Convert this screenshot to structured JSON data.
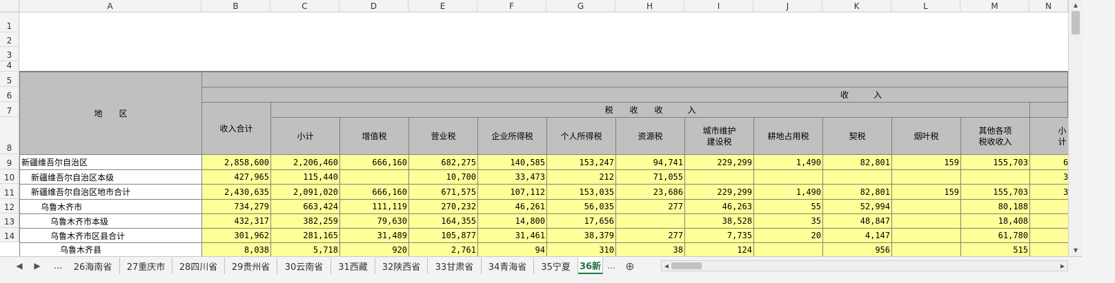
{
  "columns": [
    "A",
    "B",
    "C",
    "D",
    "E",
    "F",
    "G",
    "H",
    "I",
    "J",
    "K",
    "L",
    "M",
    "N"
  ],
  "row_numbers": [
    "1",
    "2",
    "3",
    "4",
    "5",
    "6",
    "7",
    "8",
    "9",
    "10",
    "11",
    "12",
    "13",
    "14"
  ],
  "header": {
    "region": "地　　区",
    "income_group": "收　　　入",
    "tax_group": "税　　收　　收　　　入",
    "total": "收入合计",
    "subtotal": "小计",
    "vat": "增值税",
    "business_tax": "营业税",
    "corporate_tax": "企业所得税",
    "personal_tax": "个人所得税",
    "resource_tax": "资源税",
    "urban_tax": "城市维护\n建设税",
    "land_tax": "耕地占用税",
    "deed_tax": "契税",
    "tobacco_tax": "烟叶税",
    "other_tax": "其他各项\n税收收入",
    "next_sub": "小计"
  },
  "rows": [
    {
      "name": "新疆维吾尔自治区",
      "indent": 0,
      "vals": [
        "2,858,600",
        "2,206,460",
        "666,160",
        "682,275",
        "140,585",
        "153,247",
        "94,741",
        "229,299",
        "1,490",
        "82,801",
        "159",
        "155,703",
        "6"
      ]
    },
    {
      "name": "新疆维吾尔自治区本级",
      "indent": 1,
      "vals": [
        "427,965",
        "115,440",
        "",
        "10,700",
        "33,473",
        "212",
        "71,055",
        "",
        "",
        "",
        "",
        "",
        "3"
      ]
    },
    {
      "name": "新疆维吾尔自治区地市合计",
      "indent": 1,
      "vals": [
        "2,430,635",
        "2,091,020",
        "666,160",
        "671,575",
        "107,112",
        "153,035",
        "23,686",
        "229,299",
        "1,490",
        "82,801",
        "159",
        "155,703",
        "3"
      ]
    },
    {
      "name": "乌鲁木齐市",
      "indent": 2,
      "vals": [
        "734,279",
        "663,424",
        "111,119",
        "270,232",
        "46,261",
        "56,035",
        "277",
        "46,263",
        "55",
        "52,994",
        "",
        "80,188",
        ""
      ]
    },
    {
      "name": "乌鲁木齐市本级",
      "indent": 3,
      "vals": [
        "432,317",
        "382,259",
        "79,630",
        "164,355",
        "14,800",
        "17,656",
        "",
        "38,528",
        "35",
        "48,847",
        "",
        "18,408",
        ""
      ]
    },
    {
      "name": "乌鲁木齐市区县合计",
      "indent": 3,
      "vals": [
        "301,962",
        "281,165",
        "31,489",
        "105,877",
        "31,461",
        "38,379",
        "277",
        "7,735",
        "20",
        "4,147",
        "",
        "61,780",
        ""
      ]
    },
    {
      "name": "乌鲁木齐县",
      "indent": 4,
      "vals": [
        "8,038",
        "5,718",
        "920",
        "2,761",
        "94",
        "310",
        "38",
        "124",
        "",
        "956",
        "",
        "515",
        ""
      ]
    }
  ],
  "tabs": [
    {
      "label": "...",
      "active": false
    },
    {
      "label": "26海南省",
      "active": false
    },
    {
      "label": "27重庆市",
      "active": false
    },
    {
      "label": "28四川省",
      "active": false
    },
    {
      "label": "29贵州省",
      "active": false
    },
    {
      "label": "30云南省",
      "active": false
    },
    {
      "label": "31西藏",
      "active": false
    },
    {
      "label": "32陕西省",
      "active": false
    },
    {
      "label": "33甘肃省",
      "active": false
    },
    {
      "label": "34青海省",
      "active": false
    },
    {
      "label": "35宁夏",
      "active": false
    },
    {
      "label": "36新",
      "active": true
    }
  ],
  "tab_more": "...",
  "add_sheet": "⊕",
  "nav_prev": "◀",
  "nav_next": "▶"
}
